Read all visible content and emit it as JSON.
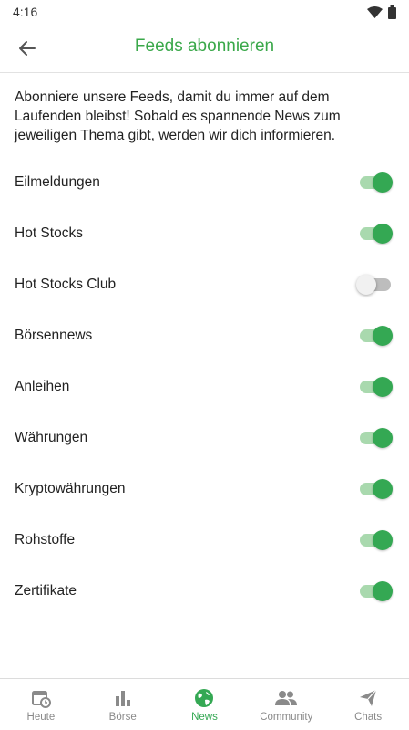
{
  "status_bar": {
    "time": "4:16"
  },
  "header": {
    "title": "Feeds abonnieren",
    "back_icon": "arrow-back-icon"
  },
  "intro_text": "Abonniere unsere Feeds, damit du immer auf dem Laufenden bleibst! Sobald es spannende News zum jeweiligen Thema gibt, werden wir dich informieren.",
  "feeds": [
    {
      "label": "Eilmeldungen",
      "enabled": true
    },
    {
      "label": "Hot Stocks",
      "enabled": true
    },
    {
      "label": "Hot Stocks Club",
      "enabled": false
    },
    {
      "label": "Börsennews",
      "enabled": true
    },
    {
      "label": "Anleihen",
      "enabled": true
    },
    {
      "label": "Währungen",
      "enabled": true
    },
    {
      "label": "Kryptowährungen",
      "enabled": true
    },
    {
      "label": "Rohstoffe",
      "enabled": true
    },
    {
      "label": "Zertifikate",
      "enabled": true
    }
  ],
  "bottom_nav": {
    "items": [
      {
        "label": "Heute",
        "icon": "calendar-clock-icon",
        "active": false
      },
      {
        "label": "Börse",
        "icon": "bar-chart-icon",
        "active": false
      },
      {
        "label": "News",
        "icon": "globe-icon",
        "active": true
      },
      {
        "label": "Community",
        "icon": "people-icon",
        "active": false
      },
      {
        "label": "Chats",
        "icon": "send-icon",
        "active": false
      }
    ]
  },
  "colors": {
    "accent": "#34a853",
    "title": "#3aa84a",
    "inactive": "#8a8a8a"
  }
}
